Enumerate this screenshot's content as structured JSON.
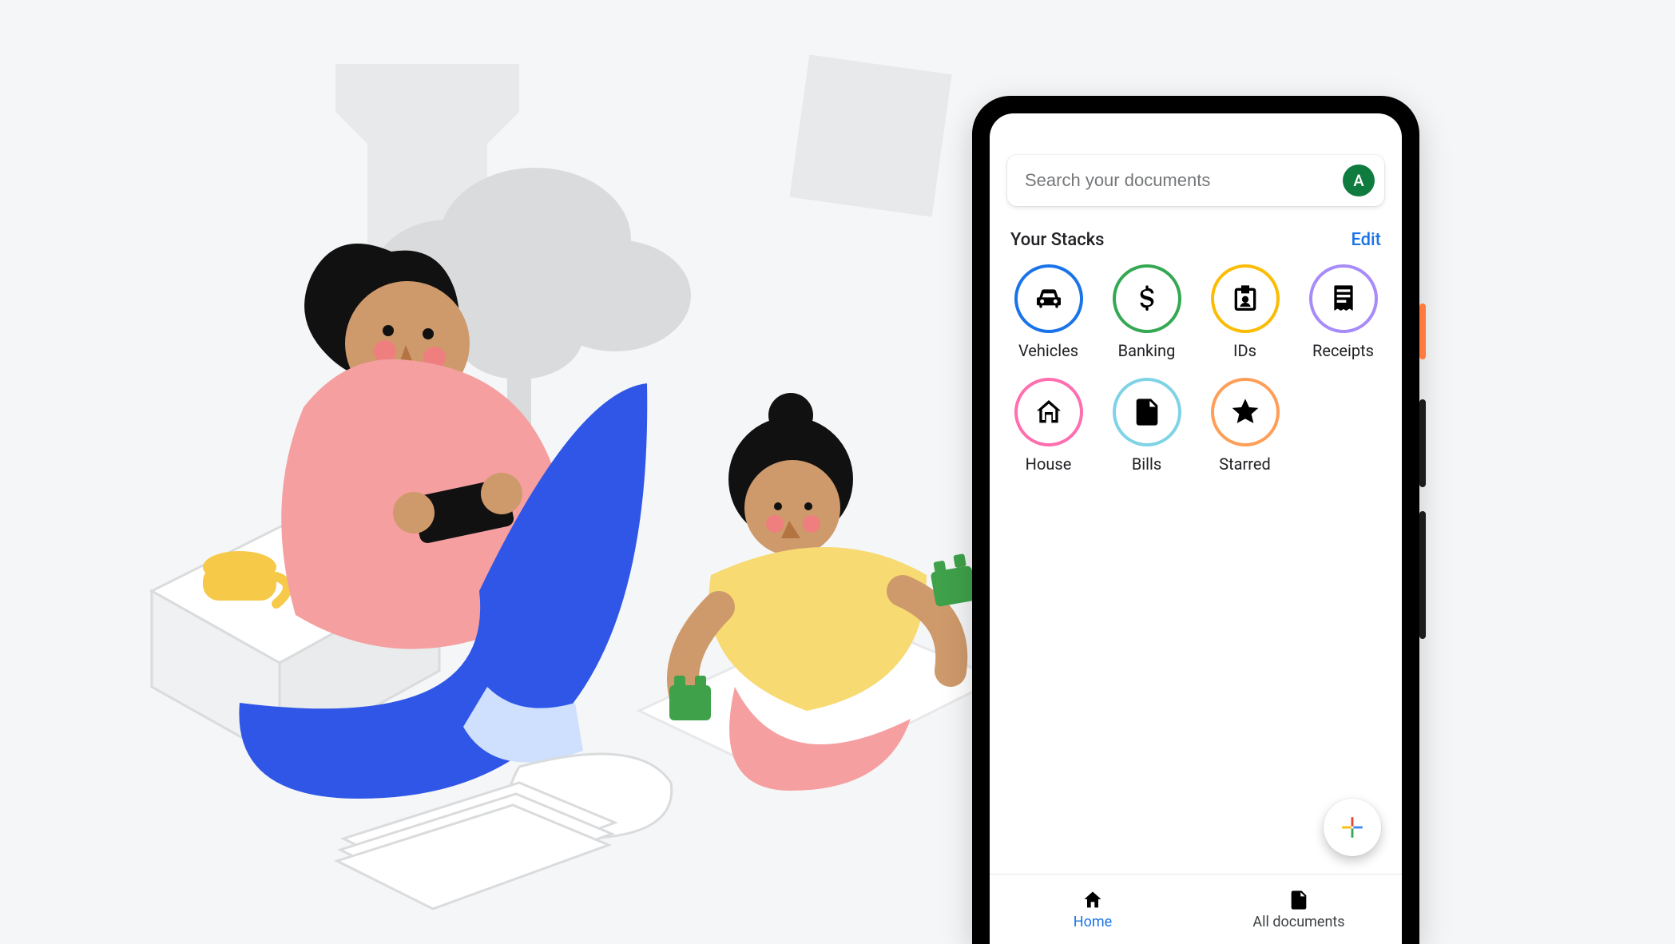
{
  "search": {
    "placeholder": "Search your documents"
  },
  "avatar": {
    "letter": "A"
  },
  "section": {
    "title": "Your Stacks",
    "edit_label": "Edit"
  },
  "stacks": [
    {
      "label": "Vehicles",
      "icon": "car-icon",
      "ring": "#1a73e8"
    },
    {
      "label": "Banking",
      "icon": "dollar-icon",
      "ring": "#34a853"
    },
    {
      "label": "IDs",
      "icon": "id-badge-icon",
      "ring": "#fbbc04"
    },
    {
      "label": "Receipts",
      "icon": "receipt-icon",
      "ring": "#a78bfa"
    },
    {
      "label": "House",
      "icon": "house-icon",
      "ring": "#ff6fb0"
    },
    {
      "label": "Bills",
      "icon": "bill-icon",
      "ring": "#7fd3e6"
    },
    {
      "label": "Starred",
      "icon": "star-icon",
      "ring": "#ff9e57"
    }
  ],
  "fab": {
    "icon": "plus-icon"
  },
  "nav": {
    "items": [
      {
        "label": "Home",
        "icon": "home-icon",
        "active": true
      },
      {
        "label": "All documents",
        "icon": "document-icon",
        "active": false
      }
    ]
  },
  "colors": {
    "google_blue": "#4285F4",
    "google_red": "#EA4335",
    "google_yellow": "#FBBC05",
    "google_green": "#34A853"
  }
}
